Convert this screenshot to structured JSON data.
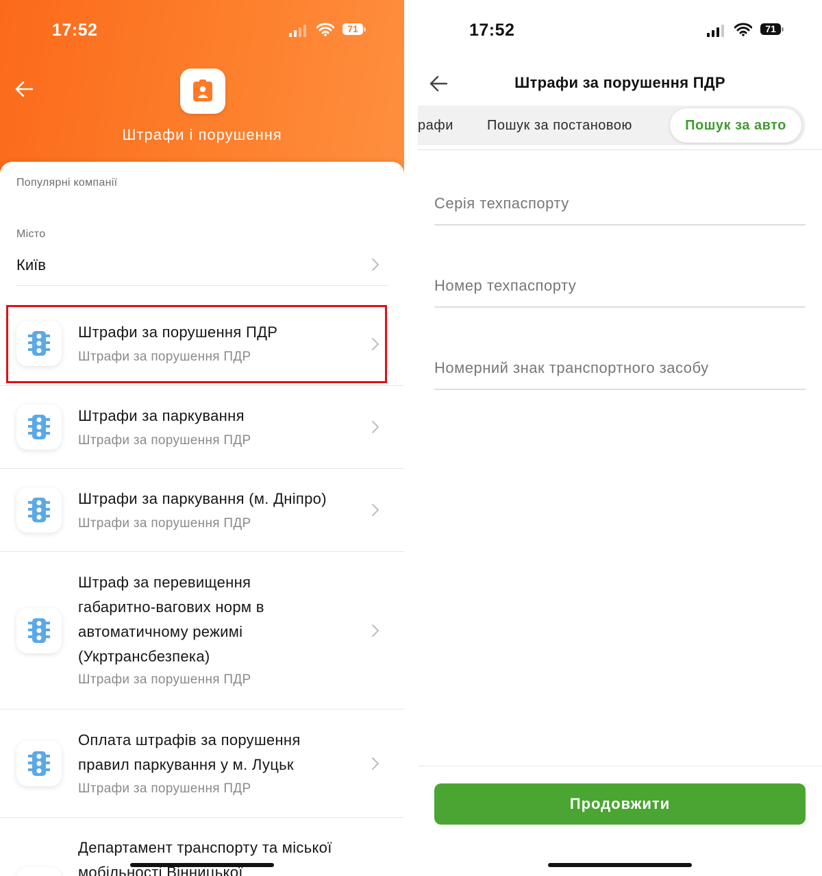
{
  "left": {
    "status": {
      "time": "17:52",
      "battery": "71"
    },
    "header": {
      "title": "Штрафи і порушення",
      "icon": "id-badge-icon"
    },
    "popular_label": "Популярні компанії",
    "city": {
      "label": "Місто",
      "value": "Київ"
    },
    "items": [
      {
        "title": "Штрафи за порушення ПДР",
        "subtitle": "Штрафи за порушення ПДР",
        "icon": "traffic-light-icon",
        "highlighted": true
      },
      {
        "title": "Штрафи за паркування",
        "subtitle": "Штрафи за порушення ПДР",
        "icon": "traffic-light-icon"
      },
      {
        "title": "Штрафи за паркування (м. Дніпро)",
        "subtitle": "Штрафи за порушення ПДР",
        "icon": "traffic-light-icon"
      },
      {
        "title": "Штраф за перевищення габаритно-вагових норм в автоматичному режимі (Укртрансбезпека)",
        "subtitle": "Штрафи за порушення ПДР",
        "icon": "traffic-light-icon"
      },
      {
        "title": "Оплата штрафів за порушення правил паркування у м. Луцьк",
        "subtitle": "Штрафи за порушення ПДР",
        "icon": "traffic-light-icon"
      },
      {
        "title": "Департамент транспорту та міської мобільності Вінницької",
        "subtitle": "",
        "icon": "traffic-light-icon"
      }
    ],
    "colors": {
      "header_orange": "#fd7a26",
      "icon_blue": "#5aa9e6",
      "highlight_red": "#e10e16"
    }
  },
  "right": {
    "status": {
      "time": "17:52",
      "battery": "71"
    },
    "title": "Штрафи за порушення ПДР",
    "tabs": [
      {
        "label": "рафи"
      },
      {
        "label": "Пошук за постановою"
      },
      {
        "label": "Пошук за авто",
        "active": true
      }
    ],
    "fields": [
      {
        "placeholder": "Серія техпаспорту",
        "value": ""
      },
      {
        "placeholder": "Номер техпаспорту",
        "value": ""
      },
      {
        "placeholder": "Номерний знак транспортного засобу",
        "value": ""
      }
    ],
    "continue_label": "Продовжити",
    "colors": {
      "accent_green": "#4aa532",
      "active_tab_text": "#3f9c2f"
    }
  }
}
